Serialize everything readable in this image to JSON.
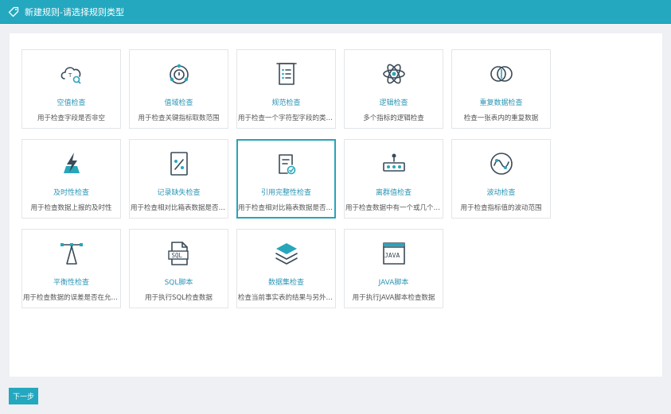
{
  "window": {
    "title": "新建规则-请选择规则类型"
  },
  "rules": [
    {
      "name": "空值检查",
      "desc": "用于检查字段是否非空",
      "icon": "cloud-search-icon"
    },
    {
      "name": "值域检查",
      "desc": "用于检查关键指标取数范围",
      "icon": "range-target-icon"
    },
    {
      "name": "规范检查",
      "desc": "用于检查一个字符型字段的类型...",
      "icon": "document-list-icon"
    },
    {
      "name": "逻辑检查",
      "desc": "多个指标的逻辑检查",
      "icon": "atom-icon"
    },
    {
      "name": "重复数据检查",
      "desc": "检查一张表内的重复数据",
      "icon": "duplicate-circles-icon"
    },
    {
      "name": "及时性检查",
      "desc": "用于检查数据上报的及时性",
      "icon": "lightning-icon"
    },
    {
      "name": "记录缺失检查",
      "desc": "用于检查相对比箱表数据是否完整",
      "icon": "missing-record-icon"
    },
    {
      "name": "引用完整性检查",
      "desc": "用于检查相对比箱表数据是否有效",
      "icon": "reference-check-icon"
    },
    {
      "name": "离群值检查",
      "desc": "用于检查数据中有一个或几个数...",
      "icon": "outlier-icon"
    },
    {
      "name": "波动检查",
      "desc": "用于检查指标值的波动范围",
      "icon": "wave-icon"
    },
    {
      "name": "平衡性检查",
      "desc": "用于检查数据的误差是否在允许...",
      "icon": "balance-icon"
    },
    {
      "name": "SQL脚本",
      "desc": "用于执行SQL检查数据",
      "icon": "sql-file-icon"
    },
    {
      "name": "数据集检查",
      "desc": "检查当前事实表的结果与另外一...",
      "icon": "layers-icon"
    },
    {
      "name": "JAVA脚本",
      "desc": "用于执行JAVA脚本检查数据",
      "icon": "java-script-icon"
    }
  ],
  "selected_index": 7,
  "buttons": {
    "next": "下一步"
  },
  "colors": {
    "accent": "#24a8bf",
    "selected_border": "#2aa3b8",
    "link": "#2b95b5"
  }
}
